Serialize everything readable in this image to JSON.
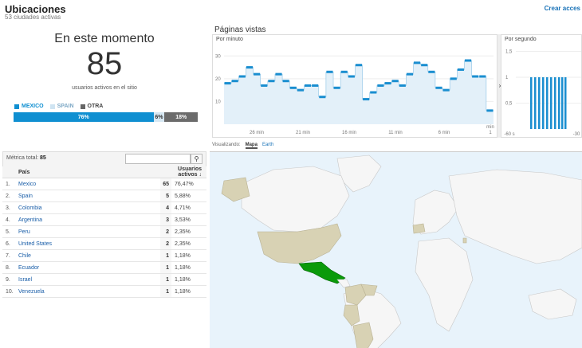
{
  "header": {
    "title": "Ubicaciones",
    "subtitle": "53 ciudades activas",
    "create_link": "Crear acces"
  },
  "realtime": {
    "label": "En este momento",
    "count": "85",
    "sub": "usuarios activos en el sitio",
    "legend": [
      {
        "label": "MEXICO",
        "color": "#0f8fd1"
      },
      {
        "label": "SPAIN",
        "color": "#cfe4f2"
      },
      {
        "label": "OTRA",
        "color": "#666666"
      }
    ],
    "bar": [
      {
        "label": "76%",
        "value": 76,
        "color": "#0f8fd1",
        "text": "#ffffff"
      },
      {
        "label": "6%",
        "value": 6,
        "color": "#d6e7f2",
        "text": "#333333"
      },
      {
        "label": "18%",
        "value": 18,
        "color": "#6b6b6b",
        "text": "#ffffff"
      }
    ]
  },
  "pageviews": {
    "title": "Páginas vistas",
    "per_minute": {
      "label": "Por minuto",
      "y_ticks": [
        "30",
        "20",
        "10"
      ],
      "x_ticks": [
        "26 min",
        "21 min",
        "16 min",
        "11 min",
        "6 min",
        "1",
        "min"
      ],
      "values": [
        18,
        19,
        21,
        25,
        22,
        17,
        19,
        22,
        19,
        16,
        15,
        17,
        17,
        12,
        23,
        16,
        23,
        21,
        26,
        11,
        14,
        17,
        18,
        19,
        17,
        22,
        27,
        26,
        23,
        16,
        15,
        20,
        24,
        28,
        21,
        21,
        6
      ]
    },
    "per_second": {
      "label": "Por segundo",
      "y_ticks": [
        "1,5",
        "1",
        "0,5"
      ],
      "x_ticks": [
        "-60 s",
        "-30"
      ],
      "values": [
        1,
        1,
        1,
        1,
        1,
        1,
        1,
        1,
        1,
        1
      ]
    }
  },
  "view_toggle": {
    "label": "Visualizando:",
    "tabs": [
      "Mapa",
      "Earth"
    ],
    "active": "Mapa"
  },
  "table": {
    "total_label": "Métrica total:",
    "total_value": "85",
    "search_placeholder": "",
    "columns": {
      "country": "País",
      "users": "Usuarios activos"
    },
    "rows": [
      {
        "idx": "1.",
        "name": "Mexico",
        "count": "65",
        "pct": "76,47%"
      },
      {
        "idx": "2.",
        "name": "Spain",
        "count": "5",
        "pct": "5,88%"
      },
      {
        "idx": "3.",
        "name": "Colombia",
        "count": "4",
        "pct": "4,71%"
      },
      {
        "idx": "4.",
        "name": "Argentina",
        "count": "3",
        "pct": "3,53%"
      },
      {
        "idx": "5.",
        "name": "Peru",
        "count": "2",
        "pct": "2,35%"
      },
      {
        "idx": "6.",
        "name": "United States",
        "count": "2",
        "pct": "2,35%"
      },
      {
        "idx": "7.",
        "name": "Chile",
        "count": "1",
        "pct": "1,18%"
      },
      {
        "idx": "8.",
        "name": "Ecuador",
        "count": "1",
        "pct": "1,18%"
      },
      {
        "idx": "9.",
        "name": "Israel",
        "count": "1",
        "pct": "1,18%"
      },
      {
        "idx": "10.",
        "name": "Venezuela",
        "count": "1",
        "pct": "1,18%"
      }
    ]
  },
  "colors": {
    "accent": "#0f8fd1",
    "link": "#1a5ea8",
    "map_highlight": "#0a9a0a",
    "map_visited": "#d8d2b4"
  }
}
